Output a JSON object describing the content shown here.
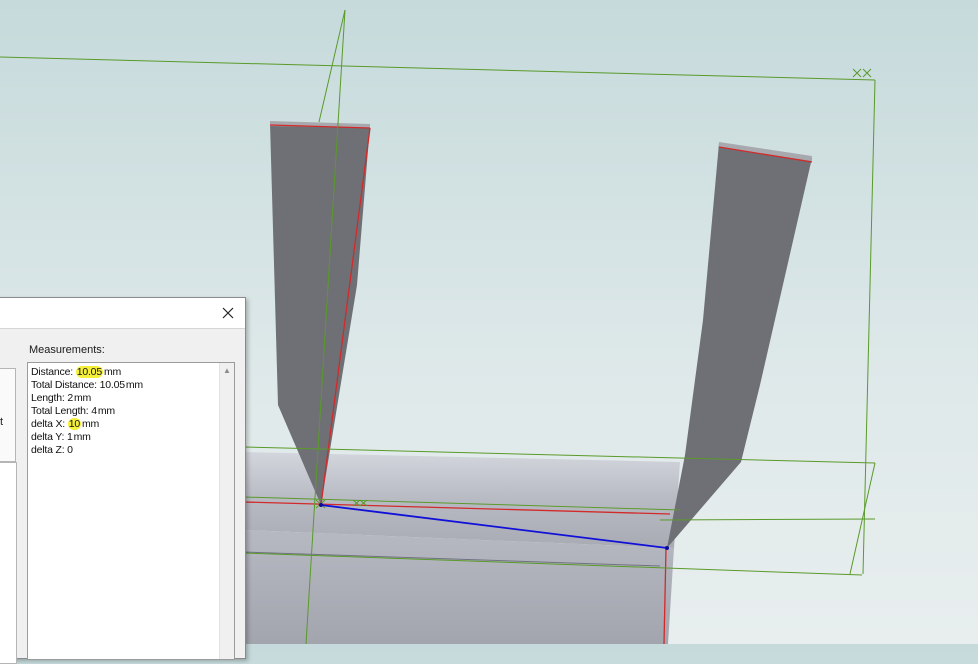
{
  "measure_dialog": {
    "close_icon": "close-icon",
    "left_fragment": "t",
    "measurements_label": "Measurements:",
    "lines": [
      {
        "label": "Distance:",
        "value": "10.05",
        "unit": "mm",
        "highlight": true
      },
      {
        "label": "Total Distance:",
        "value": "10.05",
        "unit": "mm",
        "highlight": false
      },
      {
        "label": "Length:",
        "value": "2",
        "unit": "mm",
        "highlight": false
      },
      {
        "label": "Total Length:",
        "value": "4",
        "unit": "mm",
        "highlight": false
      },
      {
        "label": "delta X:",
        "value": "10",
        "unit": "mm",
        "highlight": true
      },
      {
        "label": "delta Y:",
        "value": "1",
        "unit": "mm",
        "highlight": false
      },
      {
        "label": "delta Z:",
        "value": "0",
        "unit": "",
        "highlight": false
      }
    ],
    "highlight_color": "#f5ef3a"
  },
  "viewport": {
    "background_top": "#c6dadb",
    "background_bottom": "#e8eeee",
    "sketch_color": "#5a9a2a",
    "edge_highlight_color": "#d22a2a",
    "measure_line_color": "#1010d8",
    "body_color": "#6f7075"
  }
}
